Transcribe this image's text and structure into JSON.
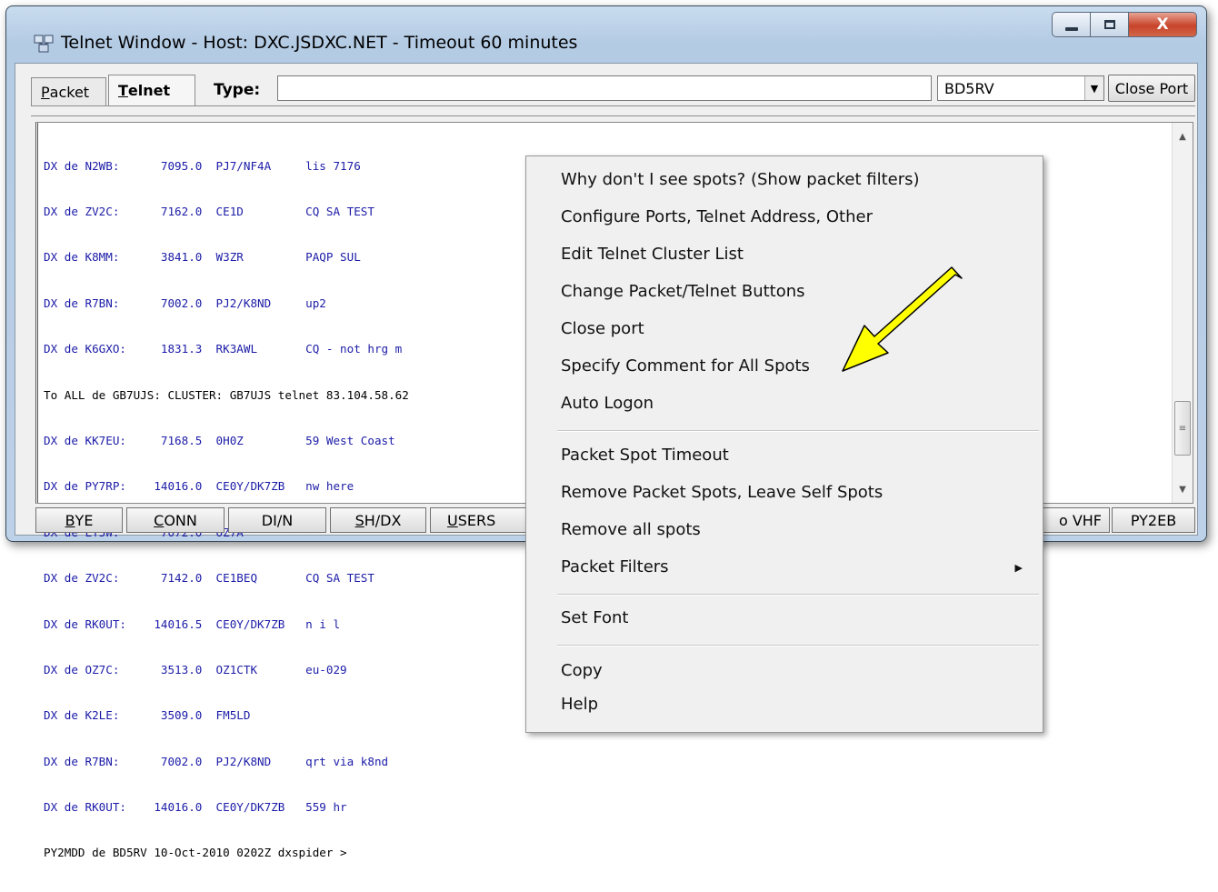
{
  "window": {
    "title": "Telnet Window - Host: DXC.JSDXC.NET - Timeout 60 minutes",
    "close_glyph": "X"
  },
  "tabs": [
    {
      "label_u": "P",
      "label_rest": "acket"
    },
    {
      "label_u": "T",
      "label_rest": "elnet"
    }
  ],
  "type_label": "Type:",
  "type_value": "",
  "host_select": {
    "value": "BD5RV"
  },
  "close_port_label": "Close Port",
  "terminal": {
    "lines": [
      "DX de N2WB:      7095.0  PJ7/NF4A     lis 7176                        0158Z",
      "DX de ZV2C:      7162.0  CE1D         CQ SA TEST                      0158Z",
      "DX de K8MM:      3841.0  W3ZR         PAQP SUL",
      "DX de R7BN:      7002.0  PJ2/K8ND     up2",
      "DX de K6GXO:     1831.3  RK3AWL       CQ - not hrg m",
      "To ALL de GB7UJS: CLUSTER: GB7UJS telnet 83.104.58.62",
      "DX de KK7EU:     7168.5  0H0Z         59 West Coast",
      "DX de PY7RP:    14016.0  CE0Y/DK7ZB   nw here",
      "DX de LY5W:      7072.0  OZ7A",
      "DX de ZV2C:      7142.0  CE1BEQ       CQ SA TEST",
      "DX de RK0UT:    14016.5  CE0Y/DK7ZB   n i l",
      "DX de OZ7C:      3513.0  OZ1CTK       eu-029",
      "DX de K2LE:      3509.0  FM5LD",
      "DX de R7BN:      7002.0  PJ2/K8ND     qrt via k8nd",
      "DX de RK0UT:    14016.0  CE0Y/DK7ZB   559 hr",
      "PY2MDD de BD5RV 10-Oct-2010 0202Z dxspider >"
    ]
  },
  "buttons": [
    {
      "u": "B",
      "rest": "YE"
    },
    {
      "u": "C",
      "rest": "ONN"
    },
    {
      "u": "",
      "rest": "DI/N"
    },
    {
      "u": "S",
      "rest": "H/DX"
    },
    {
      "u": "U",
      "rest": "SERS"
    },
    {
      "u": "",
      "rest": "o VHF"
    },
    {
      "u": "",
      "rest": "PY2EB"
    }
  ],
  "context_menu": {
    "items": [
      "Why don't I see spots? (Show packet filters)",
      "Configure Ports, Telnet Address, Other",
      "Edit Telnet Cluster List",
      "Change Packet/Telnet Buttons",
      "Close port",
      "Specify Comment for All Spots",
      "Auto Logon",
      "Packet Spot Timeout",
      "Remove Packet Spots, Leave Self Spots",
      "Remove all spots",
      "Packet Filters",
      "Set Font",
      "Copy",
      "Help"
    ]
  },
  "colors": {
    "terminal_text": "#1c1ca8",
    "arrow_fill": "#ffff00"
  }
}
